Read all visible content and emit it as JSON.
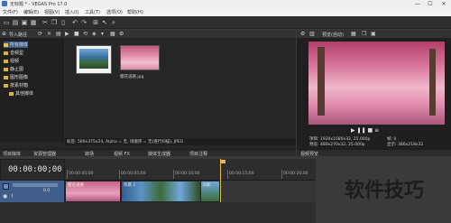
{
  "window": {
    "title": "无标题 * - VEGAS Pro 17.0",
    "minimize": "—",
    "maximize": "☐",
    "close": "✕"
  },
  "menu": [
    "文件(F)",
    "编辑(E)",
    "视图(V)",
    "插入(I)",
    "工具(T)",
    "选项(O)",
    "帮助(H)"
  ],
  "explorer": {
    "path": "导入路径",
    "tree": [
      {
        "label": "所有媒体",
        "selected": true
      },
      {
        "label": "音频型",
        "selected": false
      },
      {
        "label": "视频",
        "selected": false
      },
      {
        "label": "静止图",
        "selected": false
      },
      {
        "label": "图形图像",
        "selected": false
      },
      {
        "label": "按素材箱",
        "selected": false
      },
      {
        "label": "其他媒体",
        "selected": false
      }
    ],
    "media": [
      {
        "caption": ""
      },
      {
        "caption": "樱花道路.jpg"
      }
    ],
    "status": "标签: 500x375x24, Alpha = 无, 场顺序 = 无(逐行扫描), JPEG"
  },
  "left_tabs": [
    "项目媒体",
    "资源管理器"
  ],
  "mid_tabs": [
    "转场",
    "视频 FX",
    "媒体生成器",
    "项目注释"
  ],
  "preview": {
    "toolbar_label": "预览(自动)",
    "info": {
      "project_label": "项目:",
      "project_value": "1920x1080x32, 25.000p",
      "preview_label": "预览:",
      "preview_value": "480x270x32, 25.000p",
      "display_label": "显示:",
      "display_value": "386x218x32",
      "frame_label": "帧:",
      "frame_value": "0"
    },
    "tab": "视频预览"
  },
  "timeline": {
    "timecode": "00:00:00;00",
    "ruler_labels": [
      "00:00:00;00",
      "00:00:05;00",
      "00:00:10;00",
      "00:00:15;00",
      "00:00:20;00"
    ],
    "level": "0.0",
    "clips": [
      {
        "label": "樱花道路"
      },
      {
        "label": "风景 2"
      },
      {
        "label": "风景"
      }
    ]
  },
  "colors": {
    "accent": "#3f5f8a",
    "folder": "#d9b24a",
    "panel": "#262626"
  },
  "watermark": "软件技巧"
}
